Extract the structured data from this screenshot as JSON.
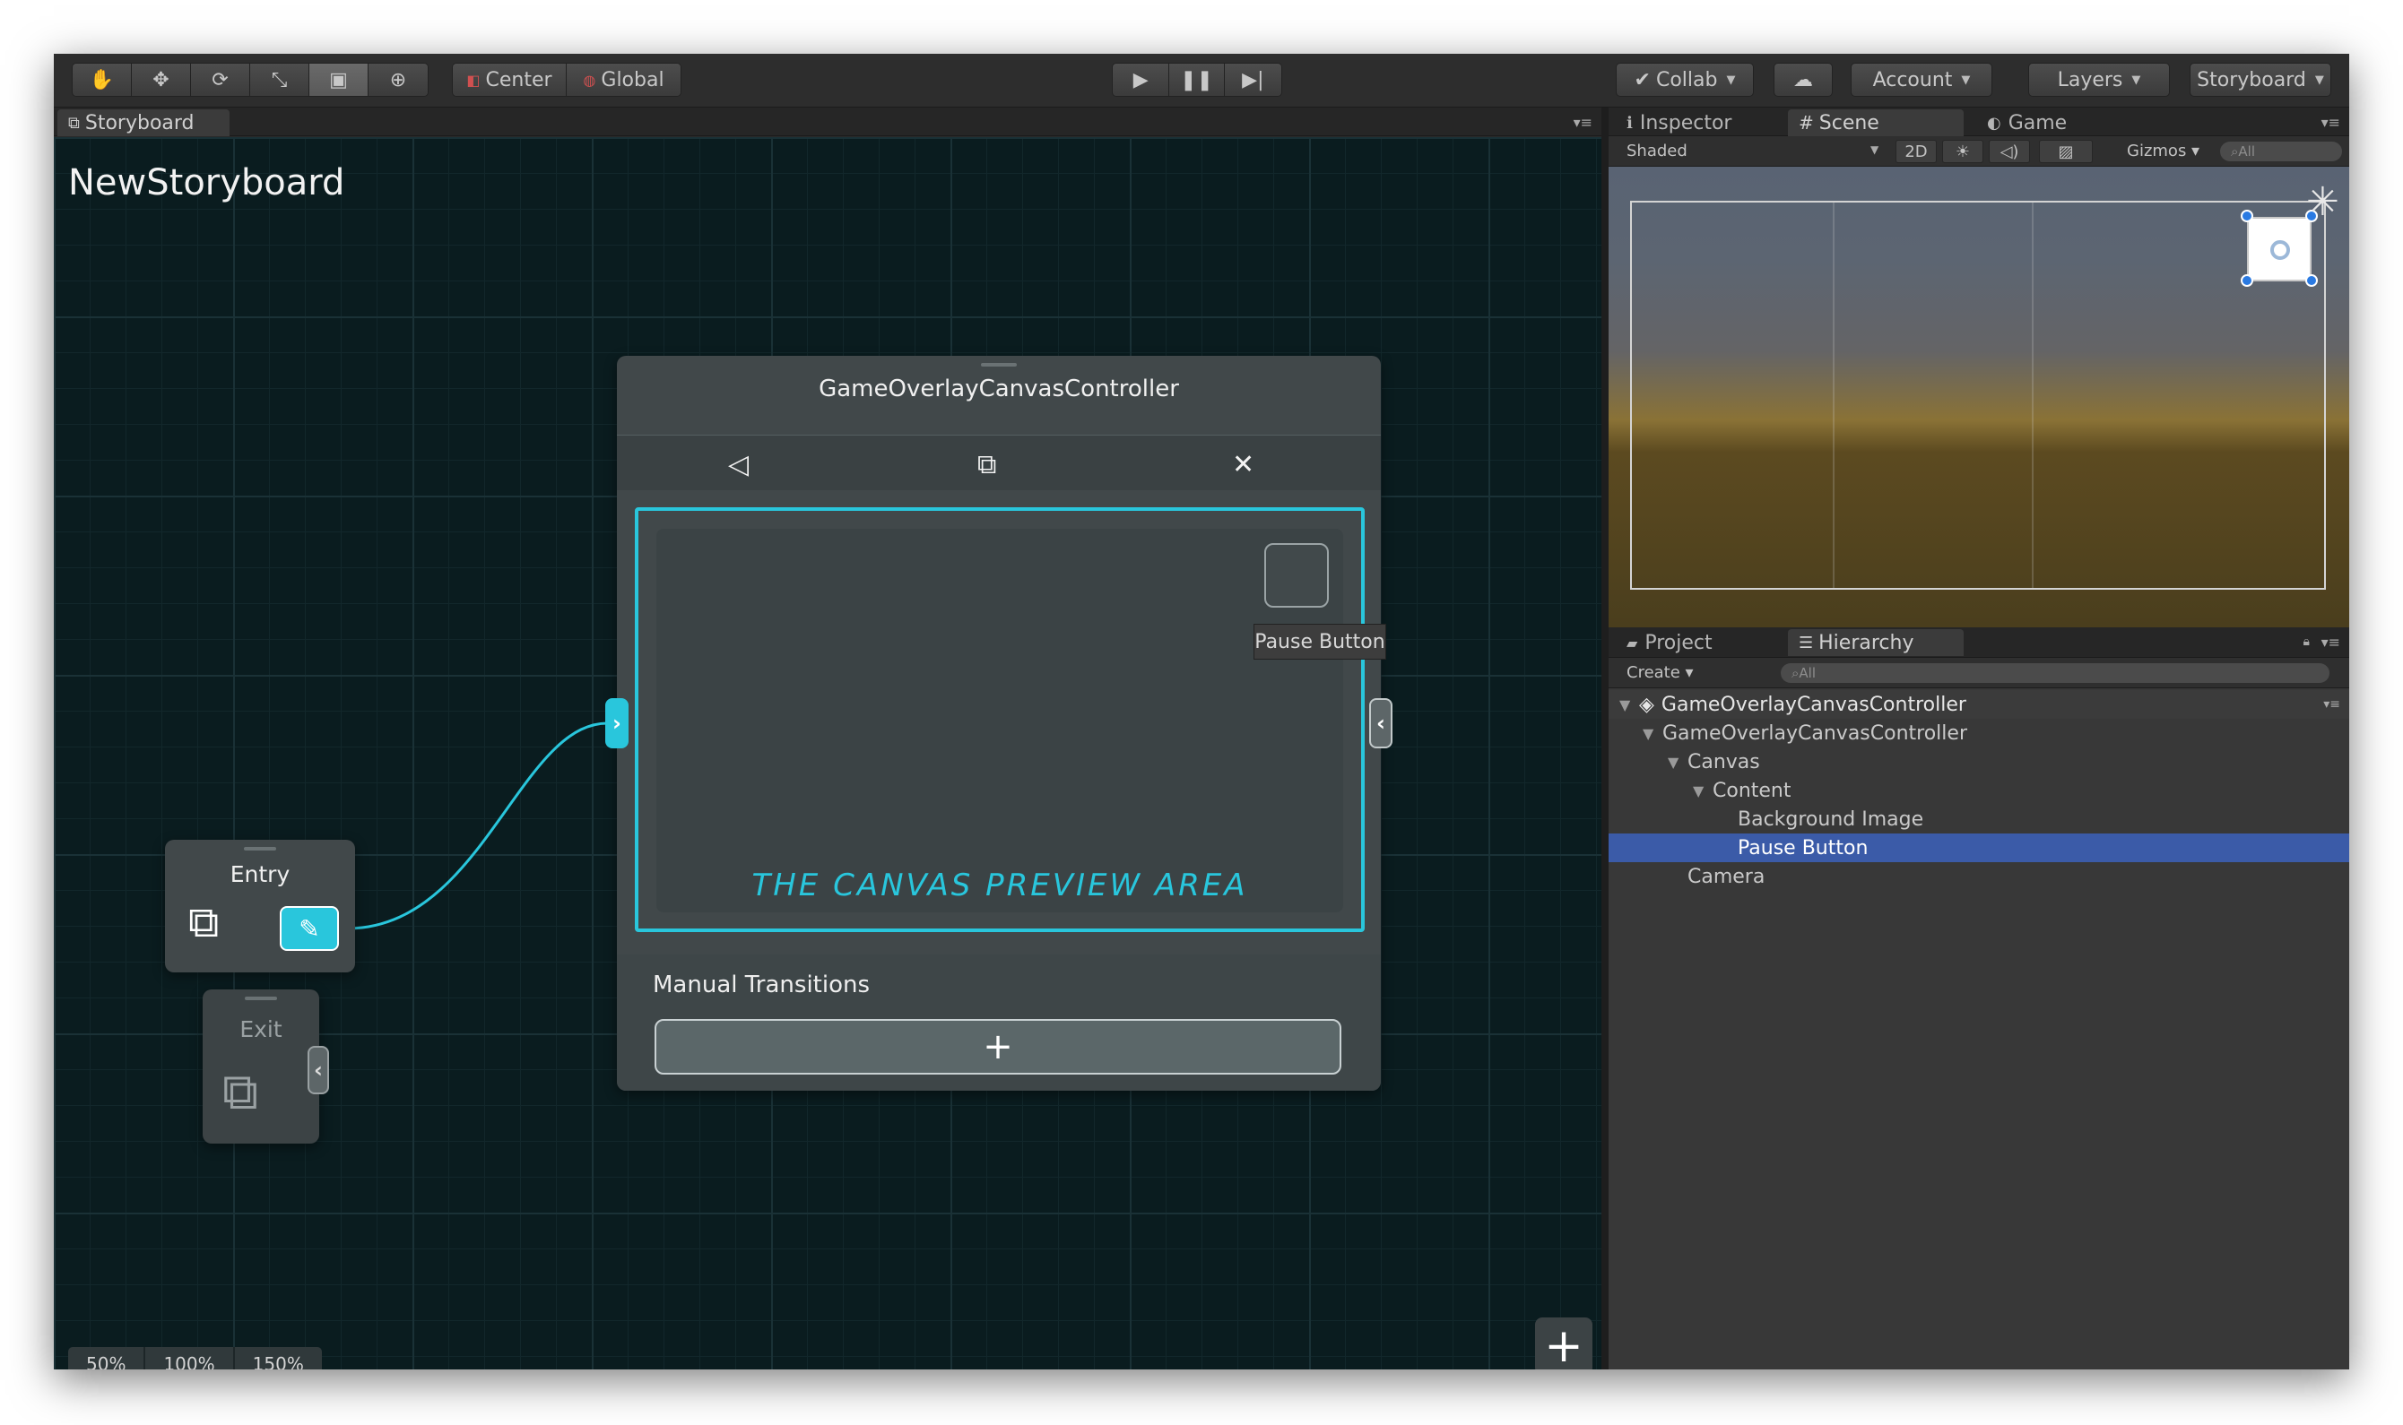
{
  "toolbar": {
    "pivot_center": "Center",
    "pivot_global": "Global",
    "collab": "Collab",
    "account": "Account",
    "layers": "Layers",
    "layout": "Storyboard"
  },
  "storyboard": {
    "tab": "Storyboard",
    "title": "NewStoryboard",
    "controller": {
      "title": "GameOverlayCanvasController",
      "preview_text": "THE CANVAS PREVIEW AREA",
      "tooltip": "Pause Button",
      "manual_transitions": "Manual Transitions",
      "add_symbol": "+"
    },
    "entry_label": "Entry",
    "exit_label": "Exit",
    "zoom_levels": [
      "50%",
      "100%",
      "150%"
    ],
    "add_symbol": "+"
  },
  "right_panel": {
    "tabs": [
      "Inspector",
      "Scene",
      "Game"
    ],
    "shading": "Shaded",
    "mode_2d": "2D",
    "gizmos": "Gizmos",
    "search_all": "All"
  },
  "hierarchy": {
    "tabs": [
      "Project",
      "Hierarchy"
    ],
    "create": "Create",
    "search_all": "All",
    "scene_name": "GameOverlayCanvasController",
    "items": [
      {
        "label": "GameOverlayCanvasController"
      },
      {
        "label": "Canvas"
      },
      {
        "label": "Content"
      },
      {
        "label": "Background Image"
      },
      {
        "label": "Pause Button",
        "selected": true
      },
      {
        "label": "Camera"
      }
    ]
  },
  "colors": {
    "accent": "#29c6dc",
    "selection": "#3b5ba8",
    "canvas_bg": "#0a1c1f"
  }
}
